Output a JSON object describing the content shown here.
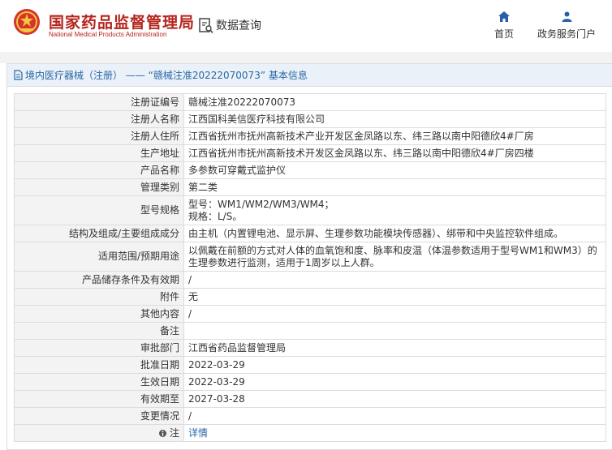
{
  "header": {
    "site_title_cn": "国家药品监督管理局",
    "site_title_en": "National Medical Products Administration",
    "section_title": "数据查询",
    "nav": {
      "home_label": "首页",
      "portal_label": "政务服务门户"
    }
  },
  "page": {
    "title": "境内医疗器械（注册） —— “赣械注准20222070073” 基本信息"
  },
  "detail": {
    "rows": [
      {
        "label": "注册证编号",
        "value": "赣械注准20222070073"
      },
      {
        "label": "注册人名称",
        "value": "江西国科美信医疗科技有限公司"
      },
      {
        "label": "注册人住所",
        "value": "江西省抚州市抚州高新技术产业开发区金凤路以东、纬三路以南中阳德欣4#厂房"
      },
      {
        "label": "生产地址",
        "value": "江西省抚州市抚州高新技术开发区金凤路以东、纬三路以南中阳德欣4#厂房四楼"
      },
      {
        "label": "产品名称",
        "value": "多参数可穿戴式监护仪"
      },
      {
        "label": "管理类别",
        "value": "第二类"
      },
      {
        "label": "型号规格",
        "value_line1": "型号：WM1/WM2/WM3/WM4；",
        "value_line2": "规格：L/S。"
      },
      {
        "label": "结构及组成/主要组成成分",
        "value": "由主机（内置锂电池、显示屏、生理参数功能模块传感器）、绑带和中央监控软件组成。"
      },
      {
        "label": "适用范围/预期用途",
        "value_line1": "以佩戴在前额的方式对人体的血氧饱和度、脉率和皮温（体温参数适用于型号WM1和WM3）的",
        "value_line2": "生理参数进行监测，适用于1周岁以上人群。"
      },
      {
        "label": "产品储存条件及有效期",
        "value": "/"
      },
      {
        "label": "附件",
        "value": "无"
      },
      {
        "label": "其他内容",
        "value": "/"
      },
      {
        "label": "备注",
        "value": ""
      },
      {
        "label": "审批部门",
        "value": "江西省药品监督管理局"
      },
      {
        "label": "批准日期",
        "value": "2022-03-29"
      },
      {
        "label": "生效日期",
        "value": "2022-03-29"
      },
      {
        "label": "有效期至",
        "value": "2027-03-28"
      },
      {
        "label": "变更情况",
        "value": "/"
      },
      {
        "label": "注",
        "value": "详情"
      }
    ]
  },
  "colors": {
    "brand_red": "#b5251c",
    "link_blue": "#2a66a6",
    "label_bg": "#f3f3f3",
    "title_bar_bg": "#eaf1f8"
  }
}
